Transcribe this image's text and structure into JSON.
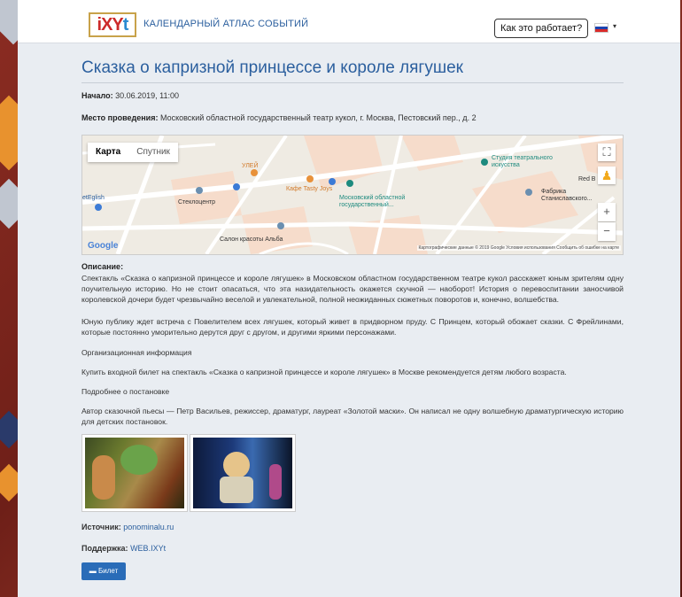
{
  "header": {
    "logo_text_a": "iXY",
    "logo_text_b": "t",
    "site_title": "КАЛЕНДАРНЫЙ АТЛАС СОБЫТИЙ",
    "how_button": "Как это работает?",
    "language_flag_icon": "ru-flag-icon"
  },
  "event": {
    "title": "Сказка о капризной принцессе и короле лягушек",
    "start_label": "Начало:",
    "start_value": "30.06.2019, 11:00",
    "venue_label": "Место проведения:",
    "venue_value": "Московский областной государственный театр кукол, г. Москва, Пестовский пер., д. 2"
  },
  "map": {
    "tab_map": "Карта",
    "tab_satellite": "Спутник",
    "labels": {
      "teatr_studio": "Студия театрального искусства",
      "mosk_obl": "Московский областной государственный...",
      "kafe": "Кафе Tasty Joys",
      "uley": "УЛЕЙ",
      "stekloc": "Стеклоцентр",
      "salon": "Салон красоты Альба",
      "fabrika": "Фабрика Станиславского...",
      "english": "etEglish",
      "redb": "Red B"
    },
    "google": "Google",
    "attribution": "Картографические данные © 2019 Google   Условия использования   Сообщить об ошибке на карте",
    "zoom_in": "+",
    "zoom_out": "−",
    "fullscreen_icon": "fullscreen-icon",
    "pegman_icon": "pegman-icon"
  },
  "description": {
    "heading": "Описание:",
    "p1": "Спектакль «Сказка о капризной принцессе и короле лягушек» в Московском областном государственном театре кукол расскажет юным зрителям одну поучительную историю. Но не стоит опасаться, что эта назидательность окажется скучной — наоборот! История о перевоспитании заносчивой королевской дочери будет чрезвычайно веселой и увлекательной, полной неожиданных сюжетных поворотов и, конечно, волшебства.",
    "p2": "Юную публику ждет встреча с Повелителем всех лягушек, который живет в придворном пруду. С Принцем, который обожает сказки. С Фрейлинами, которые постоянно уморительно дерутся друг с другом, и другими яркими персонажами.",
    "p3": "Организационная информация",
    "p4": "Купить входной билет на спектакль «Сказка о капризной принцессе и короле лягушек» в Москве рекомендуется детям любого возраста.",
    "p5": "Подробнее о постановке",
    "p6": "Автор сказочной пьесы — Петр Васильев, режиссер, драматург, лауреат «Золотой маски». Он написал не одну волшебную драматургическую историю для детских постановок."
  },
  "footer": {
    "source_label": "Источник:",
    "source_value": "ponominalu.ru",
    "support_label": "Поддержка:",
    "support_value": "WEB.IXYt",
    "ticket_button": "Билет",
    "ticket_icon": "ticket-icon"
  },
  "colors": {
    "accent": "#2b5f9e",
    "button": "#2a6cb8"
  }
}
